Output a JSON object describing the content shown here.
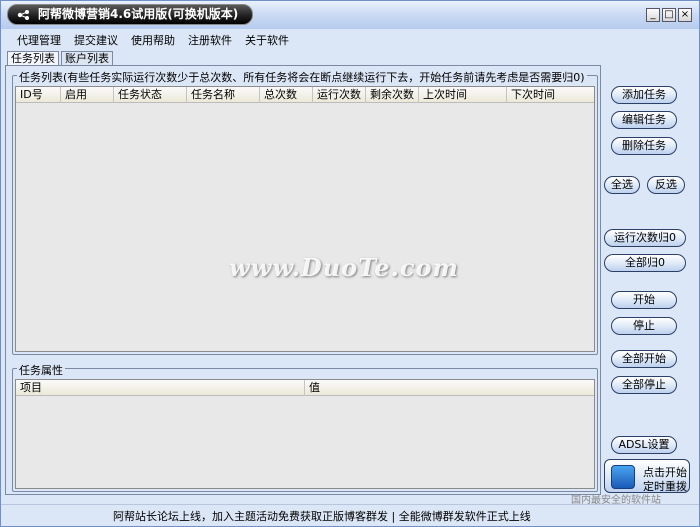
{
  "window": {
    "title": "阿帮微博营销4.6试用版(可换机版本)",
    "min_icon": "minimize-icon",
    "max_icon": "maximize-icon",
    "close_icon": "close-icon"
  },
  "menu": {
    "items": [
      "代理管理",
      "提交建议",
      "使用帮助",
      "注册软件",
      "关于软件"
    ]
  },
  "tabs": [
    "任务列表",
    "账户列表"
  ],
  "task_list": {
    "group_title": "任务列表(有些任务实际运行次数少于总次数、所有任务将会在断点继续运行下去，开始任务前请先考虑是否需要归0)",
    "columns": [
      "ID号",
      "启用",
      "任务状态",
      "任务名称",
      "总次数",
      "运行次数",
      "剩余次数",
      "上次时间",
      "下次时间"
    ]
  },
  "task_props": {
    "group_title": "任务属性",
    "columns": [
      "项目",
      "值"
    ]
  },
  "buttons": {
    "add_task": "添加任务",
    "edit_task": "编辑任务",
    "delete_task": "删除任务",
    "select_all": "全选",
    "invert": "反选",
    "reset_runs": "运行次数归0",
    "reset_all": "全部归0",
    "start": "开始",
    "stop": "停止",
    "start_all": "全部开始",
    "stop_all": "全部停止",
    "adsl": "ADSL设置",
    "timer_line1": "点击开始",
    "timer_line2": "定时重拨"
  },
  "status": {
    "text": "阿帮站长论坛上线，加入主题活动免费获取正版博客群发 | 全能微博群发软件正式上线"
  },
  "watermark": {
    "text": "www.DuoTe.com",
    "badge_text": "国内最安全的软件站"
  },
  "colors": {
    "window_bg": "#dbe6f6",
    "title_pill": "#000000",
    "list_bg": "#e8e8e8"
  }
}
